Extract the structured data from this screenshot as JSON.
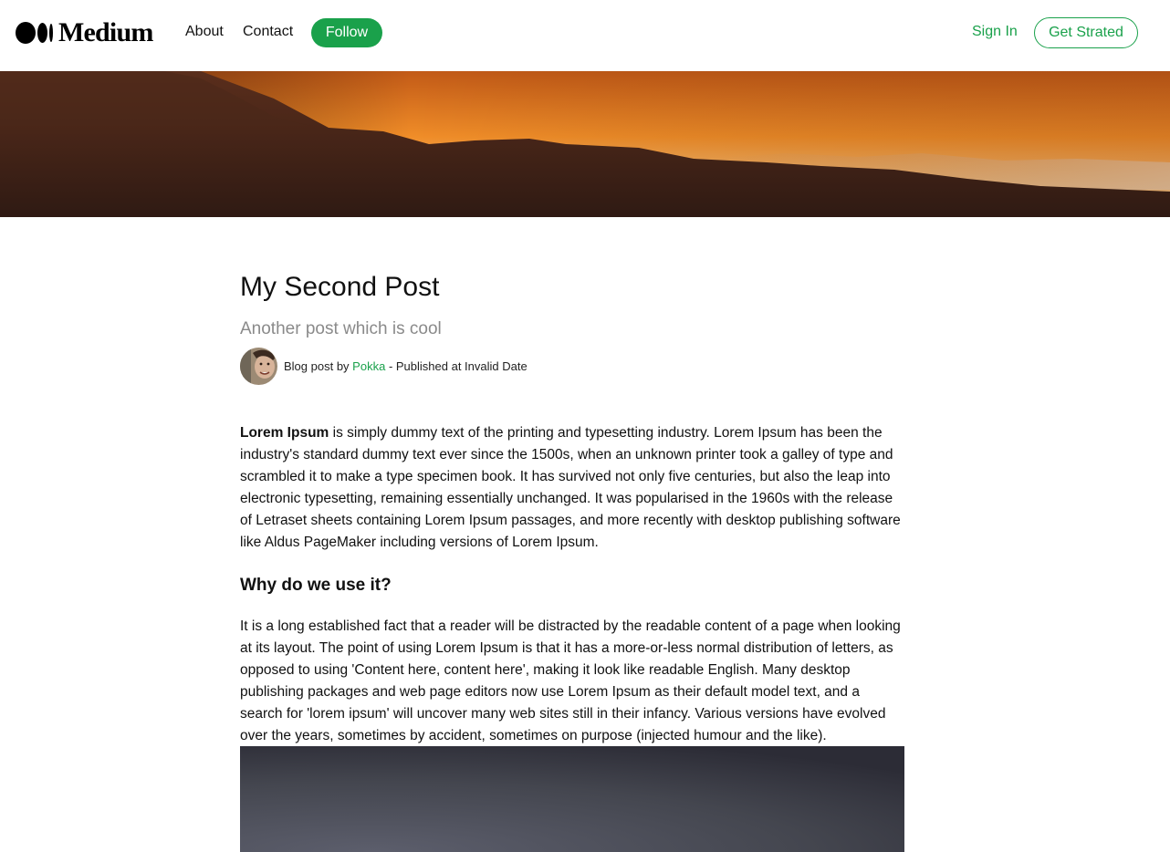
{
  "nav": {
    "logo_text": "Medium",
    "links": [
      "About",
      "Contact"
    ],
    "follow_label": "Follow",
    "signin_label": "Sign In",
    "getstarted_label": "Get Strated"
  },
  "post": {
    "title": "My Second Post",
    "subtitle": "Another post which is cool",
    "meta_prefix": "Blog post by",
    "author": "Pokka",
    "meta_suffix": "- Published at Invalid Date",
    "intro_bold": "Lorem Ipsum",
    "intro_rest": " is simply dummy text of the printing and typesetting industry. Lorem Ipsum has been the industry's standard dummy text ever since the 1500s, when an unknown printer took a galley of type and scrambled it to make a type specimen book. It has survived not only five centuries, but also the leap into electronic typesetting, remaining essentially unchanged. It was popularised in the 1960s with the release of Letraset sheets containing Lorem Ipsum passages, and more recently with desktop publishing software like Aldus PageMaker including versions of Lorem Ipsum.",
    "section_heading": "Why do we use it?",
    "section_body": "It is a long established fact that a reader will be distracted by the readable content of a page when looking at its layout. The point of using Lorem Ipsum is that it has a more-or-less normal distribution of letters, as opposed to using 'Content here, content here', making it look like readable English. Many desktop publishing packages and web page editors now use Lorem Ipsum as their default model text, and a search for 'lorem ipsum' will uncover many web sites still in their infancy. Various versions have evolved over the years, sometimes by accident, sometimes on purpose (injected humour and the like)."
  },
  "colors": {
    "accent": "#1aa14b",
    "subtitle": "#8a8a8a"
  }
}
